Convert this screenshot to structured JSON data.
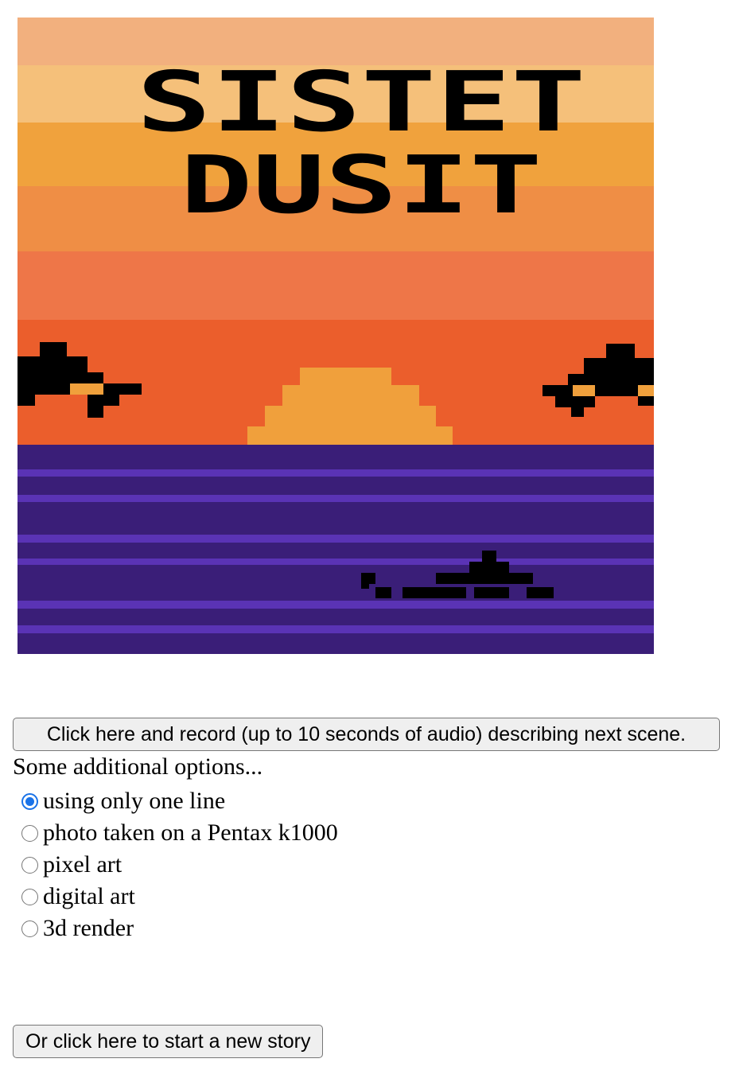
{
  "image": {
    "title_lines": [
      "SISTET",
      "DUSIT"
    ],
    "alt": "SISTET DUSIT",
    "colors": {
      "sky_bands": [
        "#f2b07e",
        "#f5c07a",
        "#f0a23d",
        "#ef8e45",
        "#ee7648",
        "#eb5e2c"
      ],
      "sun": "#f0a03c",
      "sea": "#3a1e78",
      "sea_stripe": "#5a33b5",
      "silhouette": "#000000"
    }
  },
  "record_button": {
    "label": "Click here and record (up to 10 seconds of audio) describing next scene."
  },
  "options": {
    "heading": "Some additional options...",
    "items": [
      {
        "label": "using only one line",
        "checked": true
      },
      {
        "label": "photo taken on a Pentax k1000",
        "checked": false
      },
      {
        "label": "pixel art",
        "checked": false
      },
      {
        "label": "digital art",
        "checked": false
      },
      {
        "label": "3d render",
        "checked": false
      }
    ]
  },
  "new_story_button": {
    "label": "Or click here to start a new story"
  }
}
